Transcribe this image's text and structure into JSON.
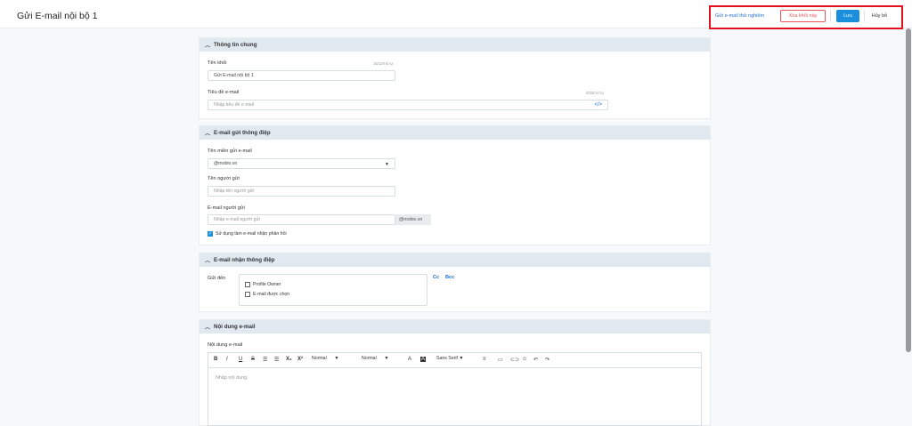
{
  "header": {
    "title": "Gửi E-mail nội bộ 1",
    "test_label": "Gửi e-mail thử nghiệm",
    "delete_label": "Xóa khối này",
    "save_label": "Lưu",
    "cancel_label": "Hủy bỏ"
  },
  "general": {
    "title": "Thông tin chung",
    "name_label": "Tên khối",
    "name_counter": "16/128 kí tự",
    "name_value": "Gửi E-mail nội bộ 1",
    "subject_label": "Tiêu đề e-mail",
    "subject_counter": "0/320 kí tự",
    "subject_placeholder": "Nhập tiêu đề e-mail",
    "code_icon": "</>"
  },
  "sender": {
    "title": "E-mail gửi thông điệp",
    "domain_label": "Tên miền gửi e-mail",
    "domain_value": "@mobio.vn",
    "name_label": "Tên người gửi",
    "name_placeholder": "Nhập tên người gửi",
    "email_label": "E-mail người gửi",
    "email_placeholder": "Nhập e-mail người gửi",
    "email_suffix": "@mobio.vn",
    "reply_label": "Sử dụng làm e-mail nhận phản hồi",
    "reply_checked": true
  },
  "receiver": {
    "title": "E-mail nhận thông điệp",
    "to_label": "Gửi đến",
    "options": [
      "Profile Owner",
      "E-mail được chọn"
    ],
    "cc": "Cc",
    "bcc": "Bcc"
  },
  "content": {
    "title": "Nội dung e-mail",
    "body_label": "Nội dung e-mail",
    "size1": "Normal",
    "size2": "Normal",
    "font": "Sans Serif",
    "placeholder": "Nhập nội dung"
  }
}
